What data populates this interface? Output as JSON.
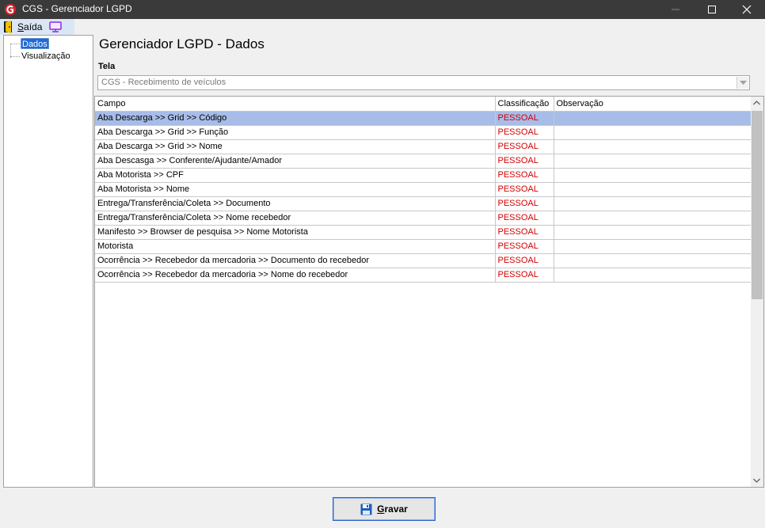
{
  "window": {
    "title": "CGS - Gerenciador LGPD"
  },
  "menu": {
    "saida_accel": "S",
    "saida_rest": "aída"
  },
  "sidebar": {
    "items": [
      {
        "label": "Dados",
        "selected": true
      },
      {
        "label": "Visualização",
        "selected": false
      }
    ]
  },
  "main": {
    "title": "Gerenciador LGPD - Dados",
    "tela_label": "Tela",
    "tela_value": "CGS - Recebimento de veículos"
  },
  "grid": {
    "columns": [
      "Campo",
      "Classificação",
      "Observação"
    ],
    "rows": [
      {
        "campo": "Aba Descarga >> Grid >> Código",
        "classificacao": "PESSOAL",
        "observacao": ""
      },
      {
        "campo": "Aba Descarga >> Grid >> Função",
        "classificacao": "PESSOAL",
        "observacao": ""
      },
      {
        "campo": "Aba Descarga >> Grid >> Nome",
        "classificacao": "PESSOAL",
        "observacao": ""
      },
      {
        "campo": "Aba Descasga >> Conferente/Ajudante/Amador",
        "classificacao": "PESSOAL",
        "observacao": ""
      },
      {
        "campo": "Aba Motorista >> CPF",
        "classificacao": "PESSOAL",
        "observacao": ""
      },
      {
        "campo": "Aba Motorista >> Nome",
        "classificacao": "PESSOAL",
        "observacao": ""
      },
      {
        "campo": "Entrega/Transferência/Coleta >> Documento",
        "classificacao": "PESSOAL",
        "observacao": ""
      },
      {
        "campo": "Entrega/Transferência/Coleta >> Nome recebedor",
        "classificacao": "PESSOAL",
        "observacao": ""
      },
      {
        "campo": "Manifesto >> Browser de pesquisa >> Nome Motorista",
        "classificacao": "PESSOAL",
        "observacao": ""
      },
      {
        "campo": "Motorista",
        "classificacao": "PESSOAL",
        "observacao": ""
      },
      {
        "campo": "Ocorrência >> Recebedor da mercadoria >> Documento do recebedor",
        "classificacao": "PESSOAL",
        "observacao": ""
      },
      {
        "campo": "Ocorrência >> Recebedor da mercadoria >> Nome do recebedor",
        "classificacao": "PESSOAL",
        "observacao": ""
      }
    ]
  },
  "footer": {
    "save_accel": "G",
    "save_rest": "ravar"
  },
  "colors": {
    "titlebar": "#3a3a3a",
    "selection": "#a7bde8",
    "classification": "#d40000",
    "tree_selection": "#1e6bd6"
  },
  "icons": {
    "app": "cgs-logo-icon",
    "exit": "exit-door-icon",
    "screen": "monitor-icon",
    "save": "floppy-disk-icon"
  }
}
